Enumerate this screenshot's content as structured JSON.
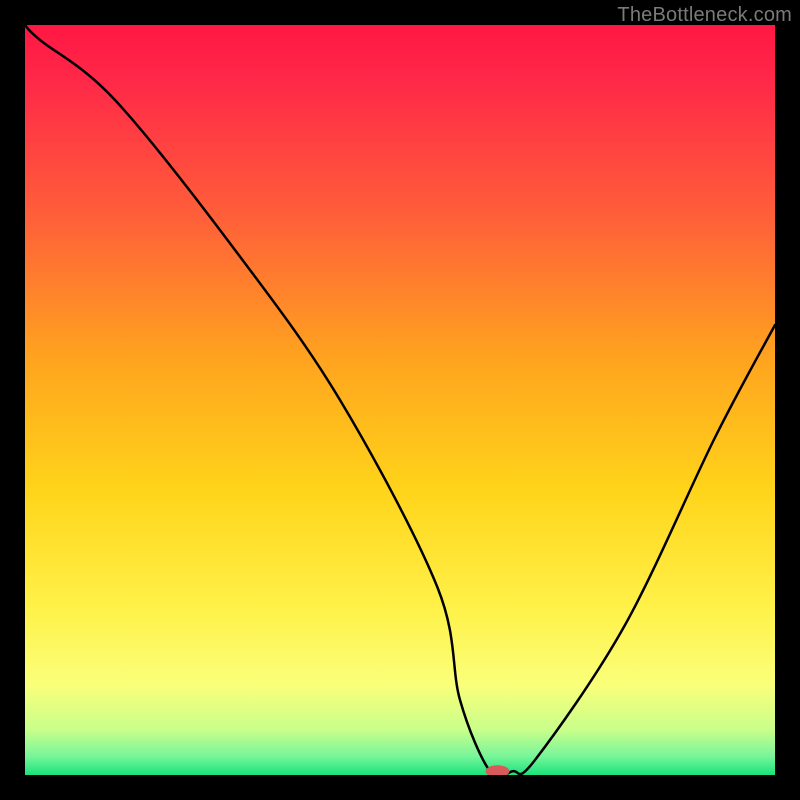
{
  "watermark": "TheBottleneck.com",
  "chart_data": {
    "type": "line",
    "title": "",
    "xlabel": "",
    "ylabel": "",
    "xlim": [
      0,
      100
    ],
    "ylim": [
      0,
      100
    ],
    "grid": false,
    "series": [
      {
        "name": "bottleneck-curve",
        "x": [
          0,
          2,
          12,
          28,
          42,
          55,
          58,
          62,
          65,
          68,
          80,
          92,
          100
        ],
        "values": [
          100,
          98,
          90,
          70,
          50,
          25,
          10,
          0.5,
          0.5,
          2,
          20,
          45,
          60
        ]
      }
    ],
    "annotations": [
      {
        "name": "red-marker",
        "x": 63,
        "y": 0.5
      }
    ],
    "background_gradient": {
      "stops": [
        {
          "offset": 0.0,
          "color": "#ff1744"
        },
        {
          "offset": 0.08,
          "color": "#ff2a48"
        },
        {
          "offset": 0.25,
          "color": "#ff5d3a"
        },
        {
          "offset": 0.45,
          "color": "#ffa51e"
        },
        {
          "offset": 0.62,
          "color": "#ffd41a"
        },
        {
          "offset": 0.78,
          "color": "#fff24a"
        },
        {
          "offset": 0.88,
          "color": "#faff7a"
        },
        {
          "offset": 0.94,
          "color": "#c8ff8a"
        },
        {
          "offset": 0.975,
          "color": "#78f59a"
        },
        {
          "offset": 1.0,
          "color": "#19e37a"
        }
      ]
    },
    "marker": {
      "color": "#d85a5a",
      "rx": 12,
      "ry": 6
    }
  }
}
